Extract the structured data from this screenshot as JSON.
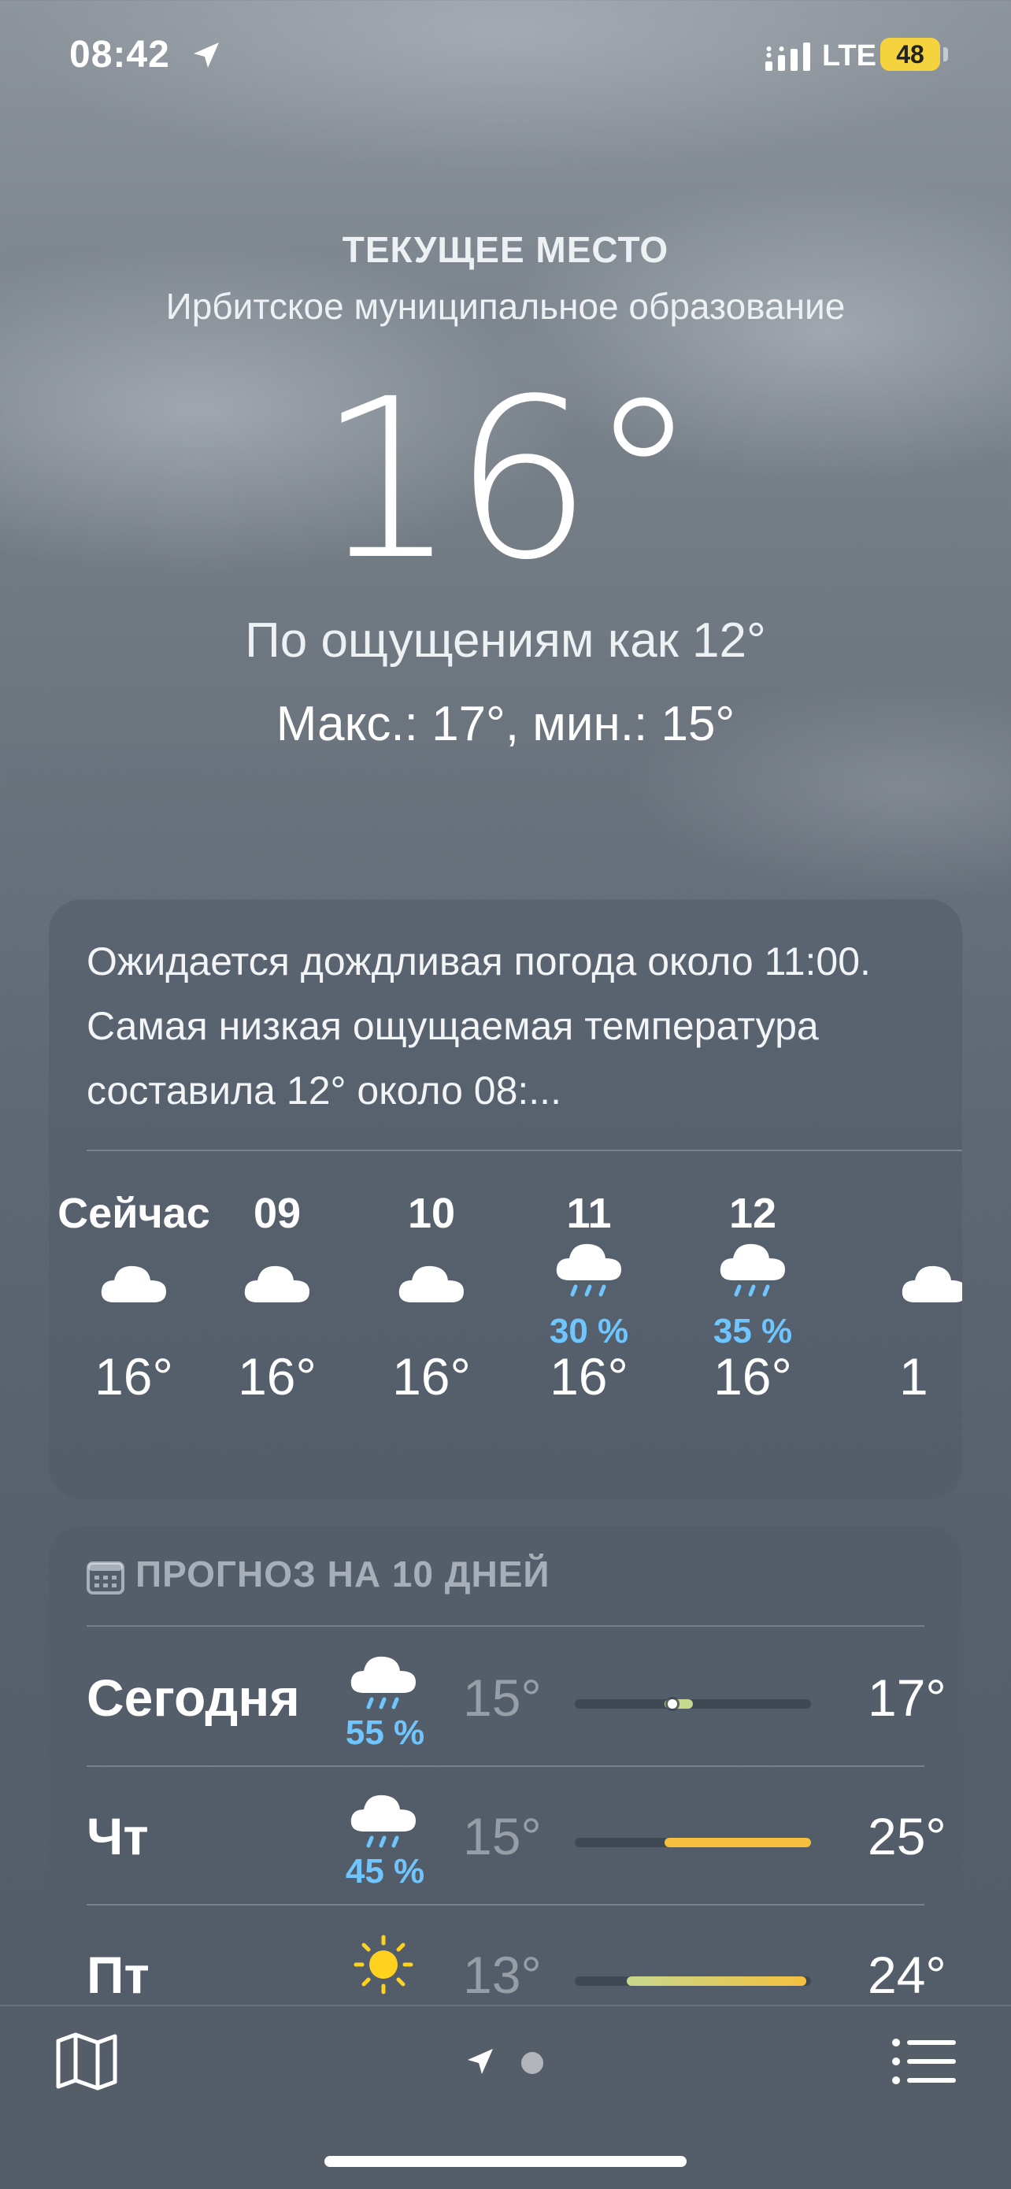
{
  "status_bar": {
    "time": "08:42",
    "network": "LTE",
    "battery": "48"
  },
  "header": {
    "location_title": "ТЕКУЩЕЕ МЕСТО",
    "location_name": "Ирбитское муниципальное образование",
    "temperature": "16°",
    "feels_like": "По ощущениям как 12°",
    "high_low": "Макс.: 17°, мин.: 15°"
  },
  "hourly": {
    "summary": "Ожидается дождливая погода около 11:00. Самая низкая ощущаемая температура составила 12° около 08:...",
    "hours": [
      {
        "label": "Сейчас",
        "icon": "cloud-icon",
        "precip": "",
        "temp": "16°"
      },
      {
        "label": "09",
        "icon": "cloud-icon",
        "precip": "",
        "temp": "16°"
      },
      {
        "label": "10",
        "icon": "cloud-icon",
        "precip": "",
        "temp": "16°"
      },
      {
        "label": "11",
        "icon": "rain-cloud-icon",
        "precip": "30 %",
        "temp": "16°"
      },
      {
        "label": "12",
        "icon": "rain-cloud-icon",
        "precip": "35 %",
        "temp": "16°"
      },
      {
        "label": "",
        "icon": "cloud-icon",
        "precip": "",
        "temp": "1"
      }
    ]
  },
  "forecast": {
    "title": "ПРОГНОЗ НА 10 ДНЕЙ",
    "days": [
      {
        "name": "Сегодня",
        "icon": "rain-cloud-icon",
        "precip": "55 %",
        "low": "15°",
        "high": "17°",
        "range_start": 0.38,
        "range_end": 0.5,
        "current": 0.42
      },
      {
        "name": "Чт",
        "icon": "rain-cloud-icon",
        "precip": "45 %",
        "low": "15°",
        "high": "25°",
        "range_start": 0.38,
        "range_end": 1.0
      },
      {
        "name": "Пт",
        "icon": "sun-icon",
        "precip": "",
        "low": "13°",
        "high": "24°",
        "range_start": 0.22,
        "range_end": 0.98
      }
    ]
  },
  "colors": {
    "precip": "#6fc6ff",
    "sun": "#ffd21f",
    "bar_warm": "#f4c03e",
    "bar_mild": "#c7d88f"
  }
}
